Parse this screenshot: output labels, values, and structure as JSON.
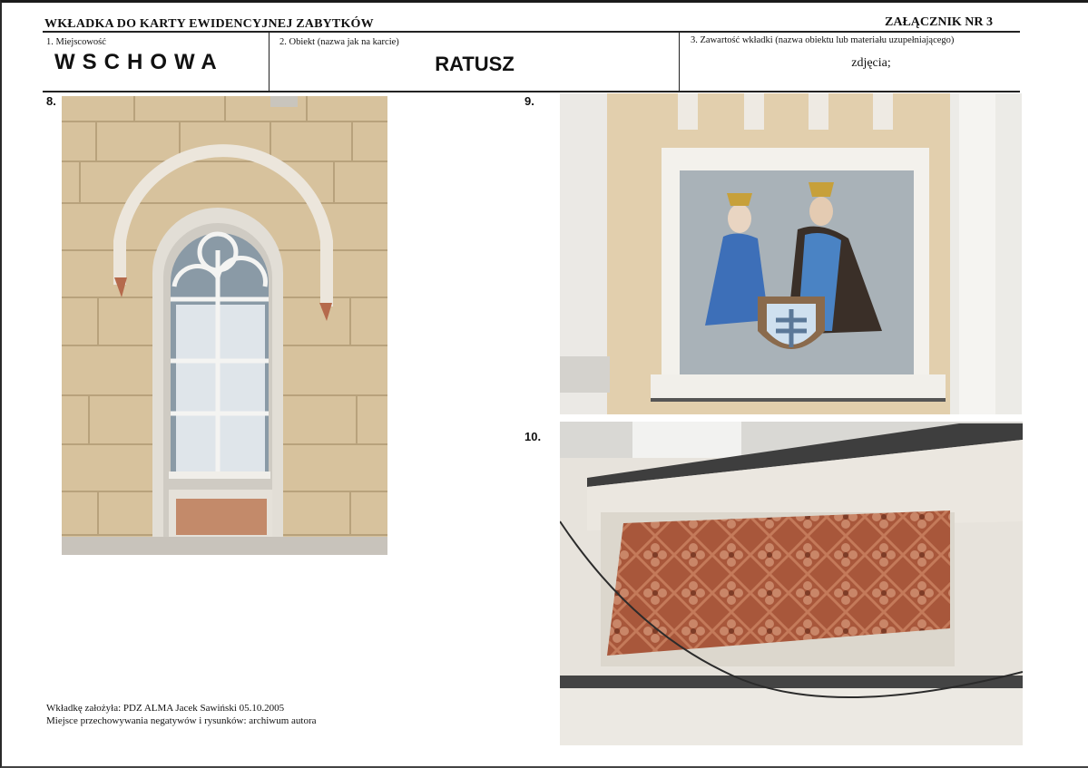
{
  "header": {
    "title": "WKŁADKA DO KARTY EWIDENCYJNEJ ZABYTKÓW",
    "annex": "ZAŁĄCZNIK NR 3"
  },
  "fields": {
    "locality_label": "1. Miejscowość",
    "locality_value": "WSCHOWA",
    "object_label": "2. Obiekt (nazwa jak na karcie)",
    "object_value": "RATUSZ",
    "content_label": "3. Zawartość wkładki (nazwa obiektu lub materiału uzupełniającego)",
    "content_value": "zdjęcia;"
  },
  "photos": [
    {
      "number": "8."
    },
    {
      "number": "9."
    },
    {
      "number": "10."
    }
  ],
  "footer": {
    "author_line": "Wkładkę założyła: PDZ ALMA  Jacek Sawiński 05.10.2005",
    "storage_line": "Miejsce przechowywania negatywów i rysunków: archiwum autora"
  },
  "colors": {
    "ink": "#111111",
    "facade": "#d9c29a",
    "stucco": "#e8e3da",
    "brick_relief": "#b06a4e"
  }
}
